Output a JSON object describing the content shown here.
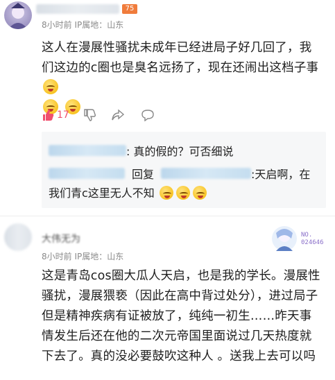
{
  "comment1": {
    "meta": "8小时前  IP属地：山东",
    "level_badge": "75",
    "text": "这人在漫展性骚扰未成年已经进局子好几回了，我们这边的c圈也是臭名远扬了，现在还闹出这档子事",
    "like_count": "17"
  },
  "replies": [
    {
      "text": ": 真的假的？可否细说"
    },
    {
      "reply_word": "回复",
      "text_part1": ":天启啊，在",
      "text_part2": "我们青c这里无人不知"
    }
  ],
  "comment2": {
    "username": "大伟无为",
    "meta": "8小时前  IP属地：山东",
    "badge_text_1": "NO.",
    "badge_text_2": "024646",
    "text": "这是青岛cos圈大瓜人天启，也是我的学长。漫展性骚扰，漫展猥亵（因此在高中背过处分），进过局子但是精神疾病有证被放了，纯纯一初生……昨天事情发生后还在他的二次元帝国里面说过几天热度就下去了。真的没必要鼓吹这种人 。送我上去可以吗"
  },
  "icons": [
    "avatar",
    "thumbs-up-icon",
    "thumbs-down-icon",
    "share-icon",
    "comment-icon",
    "laugh-emoji-icon"
  ],
  "colors": {
    "like": "#f0506e",
    "link": "#4b6f9a",
    "meta": "#8a8a8a"
  }
}
